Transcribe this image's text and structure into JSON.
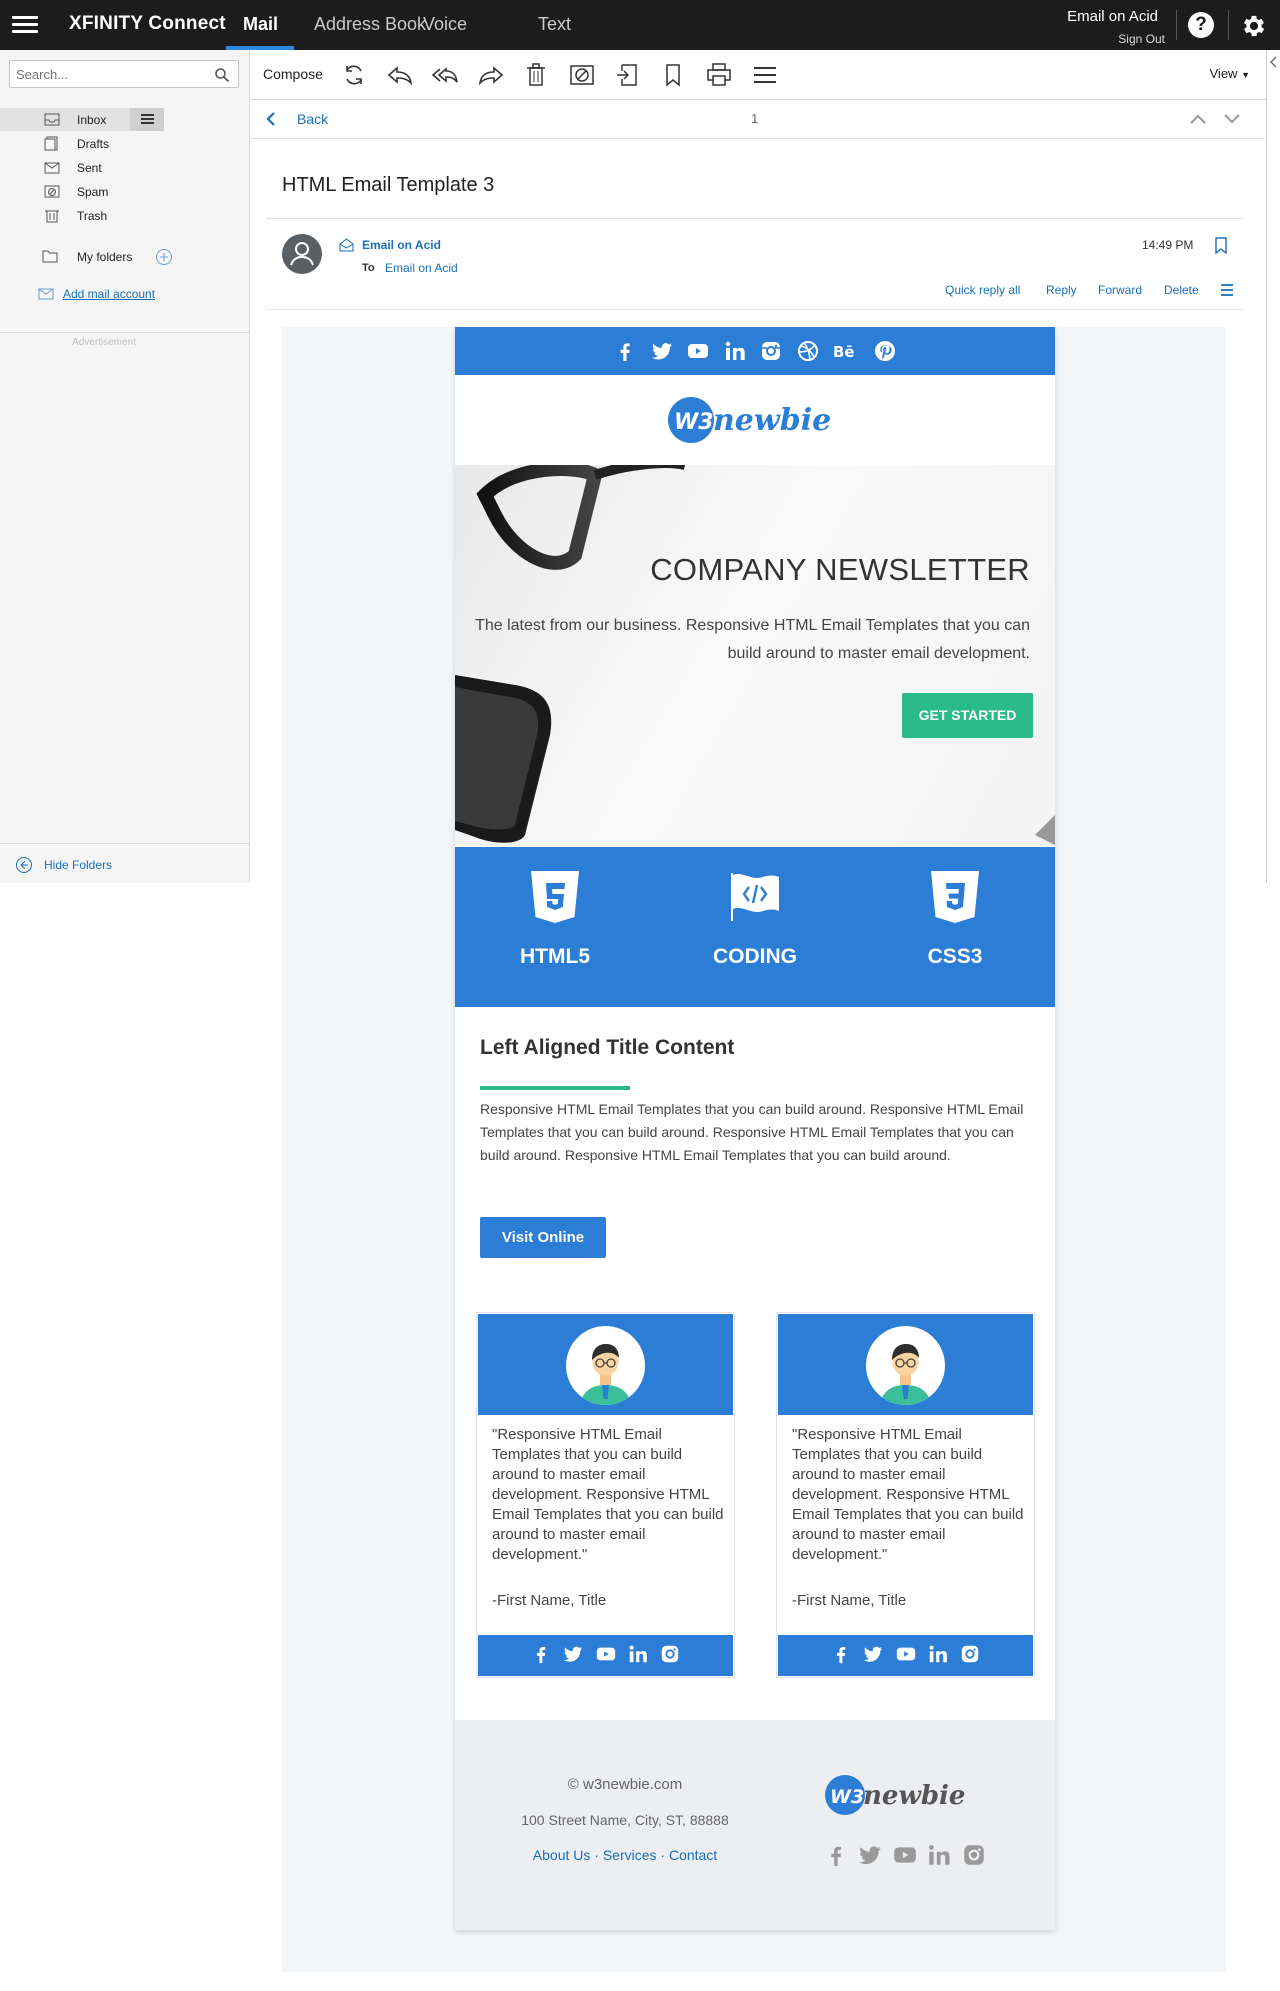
{
  "topbar": {
    "brand": "XFINITY Connect",
    "tabs": [
      {
        "label": "Mail",
        "active": true
      },
      {
        "label": "Address Book",
        "active": false
      },
      {
        "label": "Voice",
        "active": false
      },
      {
        "label": "Text",
        "active": false
      }
    ],
    "account_name": "Email on Acid",
    "sign_out": "Sign Out",
    "help_label": "?"
  },
  "sidebar": {
    "search_placeholder": "Search...",
    "folders": [
      {
        "label": "Inbox",
        "icon": "inbox-icon",
        "active": true
      },
      {
        "label": "Drafts",
        "icon": "drafts-icon",
        "active": false
      },
      {
        "label": "Sent",
        "icon": "sent-icon",
        "active": false
      },
      {
        "label": "Spam",
        "icon": "spam-icon",
        "active": false
      },
      {
        "label": "Trash",
        "icon": "trash-icon",
        "active": false
      }
    ],
    "my_folders": "My folders",
    "add_mail_account": "Add mail account",
    "advertisement": "Advertisement",
    "hide_folders": "Hide Folders"
  },
  "toolbar": {
    "compose": "Compose",
    "icons": [
      "refresh-icon",
      "reply-icon",
      "reply-all-icon",
      "forward-icon",
      "delete-icon",
      "spam-icon",
      "move-icon",
      "bookmark-icon",
      "print-icon",
      "more-icon"
    ],
    "view": "View"
  },
  "message": {
    "back": "Back",
    "page": "1",
    "subject": "HTML Email Template 3",
    "sender": "Email on Acid",
    "to_label": "To",
    "to": "Email on Acid",
    "time": "14:49 PM",
    "actions": [
      "Quick reply all",
      "Reply",
      "Forward",
      "Delete"
    ]
  },
  "email": {
    "social_icons": [
      "facebook-icon",
      "twitter-icon",
      "youtube-icon",
      "linkedin-icon",
      "instagram-icon",
      "dribbble-icon",
      "behance-icon",
      "pinterest-icon"
    ],
    "logo_text": "newbie",
    "logo_mark": "W3",
    "hero": {
      "title": "COMPANY NEWSLETTER",
      "text": "The latest from our business. Responsive HTML Email Templates that you can build around to master email development.",
      "button": "GET STARTED"
    },
    "features": [
      {
        "label": "HTML5",
        "icon": "html5-icon"
      },
      {
        "label": "CODING",
        "icon": "coding-flag-icon"
      },
      {
        "label": "CSS3",
        "icon": "css3-icon"
      }
    ],
    "section": {
      "title": "Left Aligned Title Content",
      "body": "Responsive HTML Email Templates that you can build around. Responsive HTML Email Templates that you can build around. Responsive HTML Email Templates that you can build around. Responsive HTML Email Templates that you can build around.",
      "button": "Visit Online"
    },
    "testimonials": [
      {
        "quote": "\"Responsive HTML Email Templates that you can build around to master email development. Responsive HTML Email Templates that you can build around to master email development.\"",
        "signature": "-First Name, Title"
      },
      {
        "quote": "\"Responsive HTML Email Templates that you can build around to master email development. Responsive HTML Email Templates that you can build around to master email development.\"",
        "signature": "-First Name, Title"
      }
    ],
    "card_social_icons": [
      "facebook-icon",
      "twitter-icon",
      "youtube-icon",
      "linkedin-icon",
      "instagram-icon"
    ],
    "footer": {
      "copyright": "© w3newbie.com",
      "address": "100 Street Name, City, ST, 88888",
      "links": [
        "About Us",
        "Services",
        "Contact"
      ],
      "link_separator": " · "
    }
  },
  "colors": {
    "accent_blue": "#2b7dd6",
    "green": "#2bbb8a",
    "link_blue": "#1a6fb8",
    "topbar": "#1c1c1c"
  }
}
